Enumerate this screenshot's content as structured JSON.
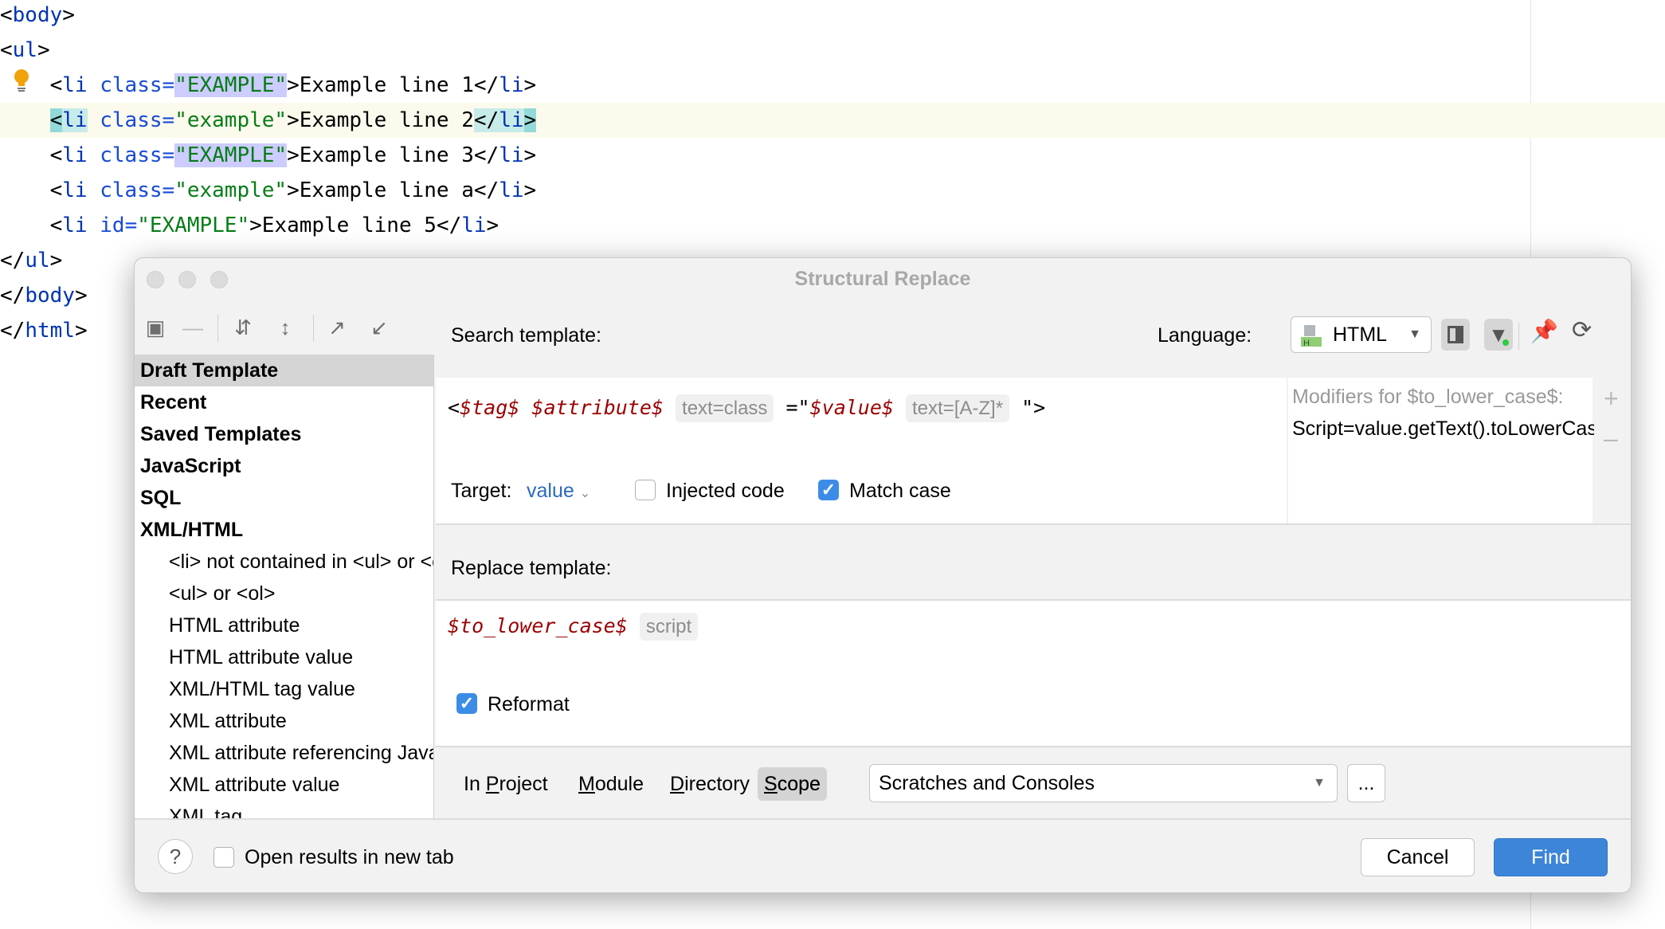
{
  "editor": {
    "lines": [
      {
        "pre": "<",
        "tag": "body",
        "post": ">"
      },
      {
        "pre": "<",
        "tag": "ul",
        "post": ">"
      },
      {
        "tag": "li",
        "attr": "class",
        "val": "\"EXAMPLE\"",
        "text": "Example line 1"
      },
      {
        "tag": "li",
        "attr": "class",
        "val": "\"example\"",
        "text": "Example line 2"
      },
      {
        "tag": "li",
        "attr": "class",
        "val": "\"EXAMPLE\"",
        "text": "Example line 3"
      },
      {
        "tag": "li",
        "attr": "class",
        "val": "\"example\"",
        "text": "Example line a"
      },
      {
        "tag": "li",
        "attr": "id",
        "val": "\"EXAMPLE\"",
        "text": "Example line 5"
      },
      {
        "pre": "</",
        "tag": "ul",
        "post": ">"
      },
      {
        "pre": "</",
        "tag": "body",
        "post": ">"
      },
      {
        "pre": "</",
        "tag": "html",
        "post": ">"
      }
    ]
  },
  "dialog": {
    "title": "Structural Replace",
    "sidebar": {
      "items": [
        {
          "label": "Draft Template",
          "bold": true,
          "selected": true
        },
        {
          "label": "Recent",
          "bold": true
        },
        {
          "label": "Saved Templates",
          "bold": true
        },
        {
          "label": "JavaScript",
          "bold": true
        },
        {
          "label": "SQL",
          "bold": true
        },
        {
          "label": "XML/HTML",
          "bold": true
        },
        {
          "label": "<li> not contained in <ul> or <ol>"
        },
        {
          "label": "<ul> or <ol>"
        },
        {
          "label": "HTML attribute"
        },
        {
          "label": "HTML attribute value"
        },
        {
          "label": "XML/HTML tag value"
        },
        {
          "label": "XML attribute"
        },
        {
          "label": "XML attribute referencing Java"
        },
        {
          "label": "XML attribute value"
        },
        {
          "label": "XML tag"
        }
      ]
    },
    "search": {
      "label": "Search template:",
      "language_label": "Language:",
      "language": "HTML",
      "t_lt": "<",
      "t_tag": "$tag$",
      "t_attr": "$attribute$",
      "t_attr_filter": "text=class",
      "t_eq": "=\"",
      "t_value": "$value$",
      "t_value_filter": "text=[A-Z]*",
      "t_end": "\">",
      "target_label": "Target:",
      "target_value": "value",
      "injected_label": "Injected code",
      "injected_checked": false,
      "match_case_label": "Match case",
      "match_case_checked": true
    },
    "modifiers": {
      "title": "Modifiers for $to_lower_case$:",
      "script": "Script=value.getText().toLowerCase()"
    },
    "replace": {
      "label": "Replace template:",
      "var": "$to_lower_case$",
      "filter": "script",
      "reformat_label": "Reformat",
      "reformat_checked": true
    },
    "scope": {
      "options": [
        "In Project",
        "Module",
        "Directory",
        "Scope"
      ],
      "selected": "Scope",
      "value": "Scratches and Consoles",
      "more": "..."
    },
    "footer": {
      "help": "?",
      "open_new_tab_label": "Open results in new tab",
      "open_new_tab_checked": false,
      "cancel": "Cancel",
      "find": "Find"
    }
  },
  "colors": {
    "accent": "#3c8ce7",
    "find_button": "#3d85d9",
    "variable": "#9b0000"
  }
}
